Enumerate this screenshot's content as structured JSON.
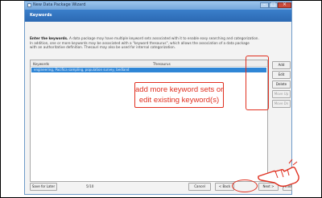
{
  "window": {
    "title": "New Data Package Wizard",
    "heading": "Keywords"
  },
  "description": {
    "bold_lead": "Enter the keywords.",
    "line1": " A data package may have multiple keyword sets associated with it to enable easy searching and categorization.",
    "line2": "In addition, one or more keywords may be associated with a \"keyword thesaurus\", which allows the association of a data package",
    "line3": "with an authoritative definition. Thesauri may also be used for internal categorization."
  },
  "table": {
    "columns": [
      "Keywords",
      "Thesaurus"
    ],
    "rows": [
      {
        "keywords": "engineering, Pacifica sampling, population survey, bedland",
        "thesaurus": ""
      }
    ]
  },
  "side_buttons": [
    {
      "label": "Add",
      "enabled": true
    },
    {
      "label": "Edit",
      "enabled": true
    },
    {
      "label": "Delete",
      "enabled": true
    },
    {
      "label": "Move Up",
      "enabled": false
    },
    {
      "label": "Move Dn",
      "enabled": false
    }
  ],
  "callout": {
    "line1": "add more keyword sets or",
    "line2": "edit existing keyword(s)"
  },
  "footer": {
    "save_label": "Save for Later",
    "step_text": "5/10",
    "cancel_label": "Cancel",
    "back_label": "< Back",
    "next_label": "Next >",
    "finish_label": "Finish"
  },
  "colors": {
    "annotation": "#e03020",
    "header_band": "#2c69b3",
    "selection": "#2f86d6"
  },
  "icons": {
    "pointer": "pointing-hand-icon"
  }
}
